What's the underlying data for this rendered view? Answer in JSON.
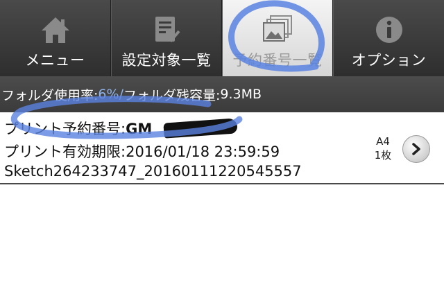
{
  "tabs": [
    {
      "label": "メニュー",
      "icon": "home-icon",
      "active": false
    },
    {
      "label": "設定対象一覧",
      "icon": "checklist-icon",
      "active": false
    },
    {
      "label": "予約番号一覧",
      "icon": "image-stack-icon",
      "active": true
    },
    {
      "label": "オプション",
      "icon": "info-icon",
      "active": false
    }
  ],
  "status": {
    "usage_label": "フォルダ使用率:",
    "usage_value": "6%",
    "separator": " / ",
    "remaining_label": "フォルダ残容量:",
    "remaining_value": "9.3MB"
  },
  "list": {
    "items": [
      {
        "reservation_label": "プリント予約番号:",
        "reservation_number_visible": "GM",
        "expiry_label": "プリント有効期限:",
        "expiry_value": "2016/01/18 23:59:59",
        "filename": "Sketch264233747_20160111220545557",
        "paper_size": "A4",
        "copies": "1枚"
      }
    ]
  },
  "colors": {
    "tab_bg": "#3a3a3a",
    "tab_active_bg": "#e6e6e6",
    "status_bg": "#444444",
    "status_highlight": "#8fb3ea",
    "annotation": "#5b82e0"
  }
}
